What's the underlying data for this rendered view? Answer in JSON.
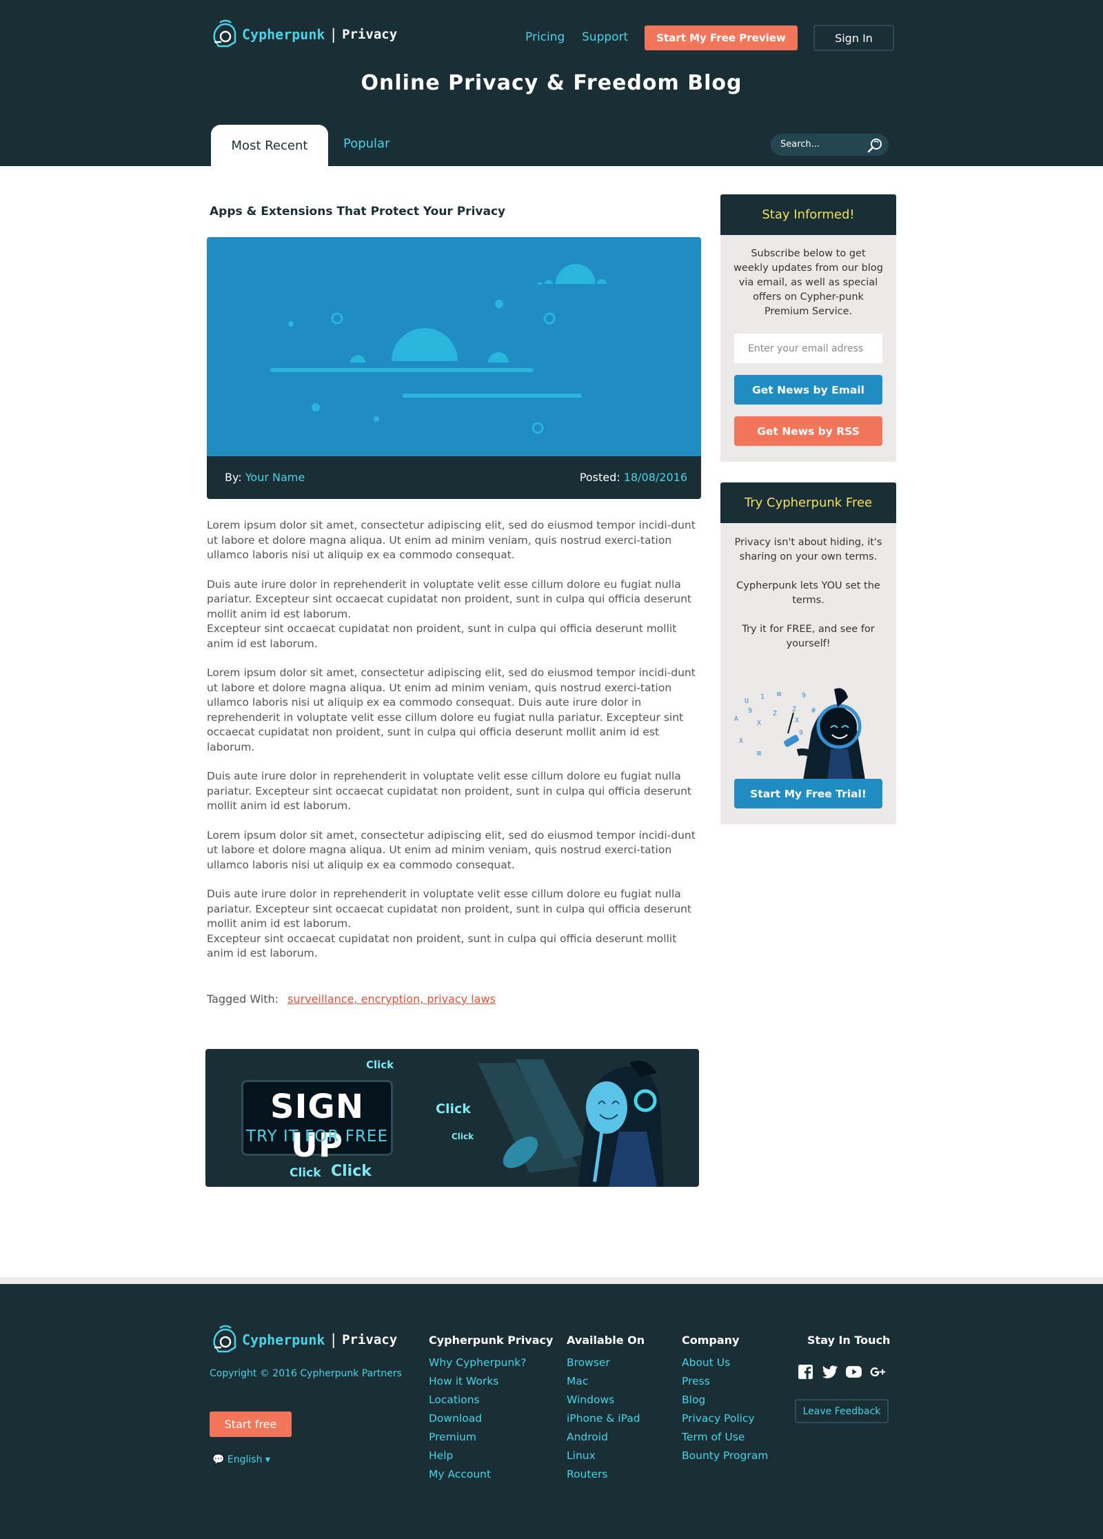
{
  "brand": {
    "name": "Cypherpunk",
    "suffix": "Privacy"
  },
  "nav": {
    "pricing": "Pricing",
    "support": "Support",
    "preview_button": "Start My Free Preview",
    "signin_button": "Sign In"
  },
  "page_title": "Online Privacy & Freedom Blog",
  "tabs": {
    "most_recent": "Most Recent",
    "popular": "Popular"
  },
  "search": {
    "placeholder": "Search..."
  },
  "article": {
    "title": "Apps & Extensions That Protect Your Privacy",
    "by_label": "By:",
    "author": "Your Name",
    "posted_label": "Posted:",
    "date": "18/08/2016",
    "paragraphs": [
      "Lorem ipsum dolor sit amet, consectetur adipiscing elit, sed do eiusmod tempor incidi-dunt ut labore et dolore magna aliqua. Ut enim ad minim veniam, quis nostrud exerci-tation ullamco laboris nisi ut aliquip ex ea commodo consequat.",
      "Duis aute irure dolor in reprehenderit in voluptate velit esse cillum dolore eu fugiat nulla pariatur. Excepteur sint occaecat cupidatat non proident, sunt in culpa qui officia deserunt mollit anim id est laborum.",
      "Excepteur sint occaecat cupidatat non proident, sunt in culpa qui officia deserunt mollit anim id est laborum.",
      "Lorem ipsum dolor sit amet, consectetur adipiscing elit, sed do eiusmod tempor incidi-dunt ut labore et dolore magna aliqua. Ut enim ad minim veniam, quis nostrud exerci-tation ullamco laboris nisi ut aliquip ex ea commodo consequat. Duis aute irure dolor in reprehenderit in voluptate velit esse cillum dolore eu fugiat nulla pariatur. Excepteur sint occaecat cupidatat non proident, sunt in culpa qui officia deserunt mollit anim id est laborum.",
      "Duis aute irure dolor in reprehenderit in voluptate velit esse cillum dolore eu fugiat nulla pariatur. Excepteur sint occaecat cupidatat non proident, sunt in culpa qui officia deserunt mollit anim id est laborum.",
      "Lorem ipsum dolor sit amet, consectetur adipiscing elit, sed do eiusmod tempor incidi-dunt ut labore et dolore magna aliqua. Ut enim ad minim veniam, quis nostrud exerci-tation ullamco laboris nisi ut aliquip ex ea commodo consequat.",
      "Duis aute irure dolor in reprehenderit in voluptate velit esse cillum dolore eu fugiat nulla pariatur. Excepteur sint occaecat cupidatat non proident, sunt in culpa qui officia deserunt mollit anim id est laborum.",
      "Excepteur sint occaecat cupidatat non proident, sunt in culpa qui officia deserunt mollit anim id est laborum."
    ],
    "tagged_label": "Tagged With:",
    "tags": "surveillance, encryption, privacy laws"
  },
  "banner": {
    "headline": "SIGN UP",
    "subline": "TRY IT FOR FREE",
    "click": "Click"
  },
  "sidebar": {
    "stay_informed": {
      "title": "Stay Informed!",
      "text": "Subscribe below to get weekly updates from our blog via email, as well as special offers on Cypher-punk Premium Service.",
      "email_placeholder": "Enter your email adress",
      "email_button": "Get News by Email",
      "rss_button": "Get News by RSS"
    },
    "try_free": {
      "title": "Try Cypherpunk Free",
      "text1": "Privacy isn't about hiding, it's sharing on your own terms.",
      "text2": "Cypherpunk lets YOU set the terms.",
      "text3": "Try it for FREE, and see for yourself!",
      "button": "Start My Free Trial!"
    }
  },
  "footer": {
    "copyright": "Copyright © 2016 Cypherpunk Partners",
    "start_button": "Start free",
    "language": "English",
    "columns": [
      {
        "title": "Cypherpunk Privacy",
        "items": [
          "Why Cypherpunk?",
          "How it Works",
          "Locations",
          "Download",
          "Premium",
          "Help",
          "My Account"
        ]
      },
      {
        "title": "Available On",
        "items": [
          "Browser",
          "Mac",
          "Windows",
          "iPhone & iPad",
          "Android",
          "Linux",
          "Routers"
        ]
      },
      {
        "title": "Company",
        "items": [
          "About Us",
          "Press",
          "Blog",
          "Privacy Policy",
          "Term of Use",
          "Bounty Program"
        ]
      }
    ],
    "stay_in_touch": "Stay In Touch",
    "social": [
      "facebook-icon",
      "twitter-icon",
      "youtube-icon",
      "google-plus-icon"
    ],
    "feedback_button": "Leave Feedback"
  },
  "colors": {
    "navy": "#1a2e36",
    "cyan": "#49d3e6",
    "coral": "#f2775a",
    "blue": "#1f8cc4",
    "yellow": "#f4e05e"
  }
}
